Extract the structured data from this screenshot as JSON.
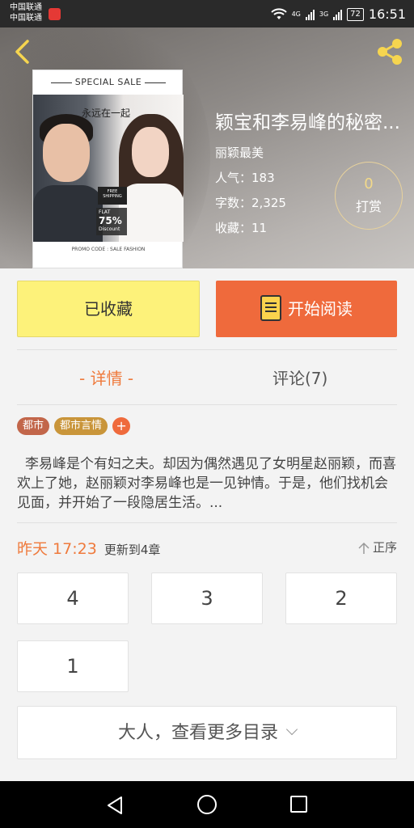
{
  "status_bar": {
    "carrier_line1": "中国联通",
    "carrier_line2": "中国联通",
    "network1": "4G",
    "network2": "3G",
    "battery": "72",
    "time": "16:51"
  },
  "cover": {
    "sale_text": "SPECIAL SALE",
    "title_text": "永远在一起",
    "sign_text": "FREE SHIPPING",
    "flat_text": "FLAT",
    "percent_text": "75%",
    "discount_text": "Discount",
    "promo_text": "PROMO CODE : SALE FASHION"
  },
  "book": {
    "title": "颖宝和李易峰的秘密...",
    "author": "丽颖最美",
    "popularity": "人气：183",
    "word_count": "字数：2,325",
    "favorites": "收藏：11",
    "reward_count": "0",
    "reward_label": "打赏"
  },
  "actions": {
    "favorited_label": "已收藏",
    "read_label": "开始阅读"
  },
  "tabs": {
    "detail": "- 详情 -",
    "comments": "评论(7)"
  },
  "tags": [
    "都市",
    "都市言情",
    "+"
  ],
  "description": "李易峰是个有妇之夫。却因为偶然遇见了女明星赵丽颖，而喜欢上了她，赵丽颖对李易峰也是一见钟情。于是，他们找机会见面，并开始了一段隐居生活。...",
  "update": {
    "time": "昨天 17:23",
    "text": "更新到4章",
    "sort_label": "正序"
  },
  "chapters": [
    "4",
    "3",
    "2",
    "1"
  ],
  "more_catalog": "大人，查看更多目录",
  "colors": {
    "accent": "#ef6a3c",
    "favorite_bg": "#fdf27a",
    "tab_active": "#ef7a3c"
  }
}
